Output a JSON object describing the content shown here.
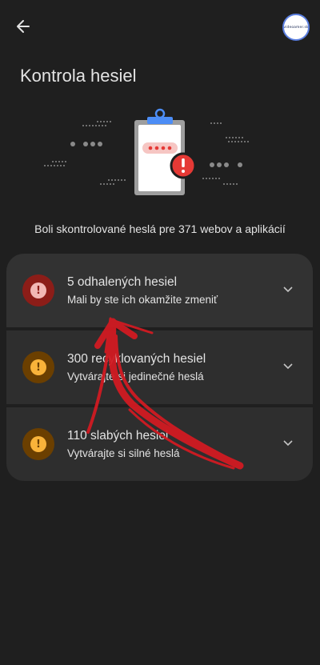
{
  "header": {
    "back_icon": "arrow-back-icon",
    "avatar_text": "videoamer.sk"
  },
  "page": {
    "title": "Kontrola hesiel",
    "summary": "Boli skontrolované heslá pre 371 webov a aplikácií"
  },
  "issues": [
    {
      "title": "5 odhalených hesiel",
      "subtitle": "Mali by ste ich okamžite zmeniť",
      "icon": "error-icon",
      "color_outer": "#8c1d18",
      "color_inner": "#f2b8b5"
    },
    {
      "title": "300 recyklovaných hesiel",
      "subtitle": "Vytvárajte si jedinečné heslá",
      "icon": "warning-icon",
      "color_outer": "#6b3f00",
      "color_inner": "#f9b33a"
    },
    {
      "title": "110 slabých hesiel",
      "subtitle": "Vytvárajte si silné heslá",
      "icon": "warning-icon",
      "color_outer": "#6b3f00",
      "color_inner": "#f9b33a"
    }
  ],
  "colors": {
    "background": "#1f1f1f",
    "card": "#2e2e2e",
    "annotation_arrow": "#d11a22",
    "clipboard_clip": "#4c8df6",
    "alert_red": "#e53935"
  }
}
